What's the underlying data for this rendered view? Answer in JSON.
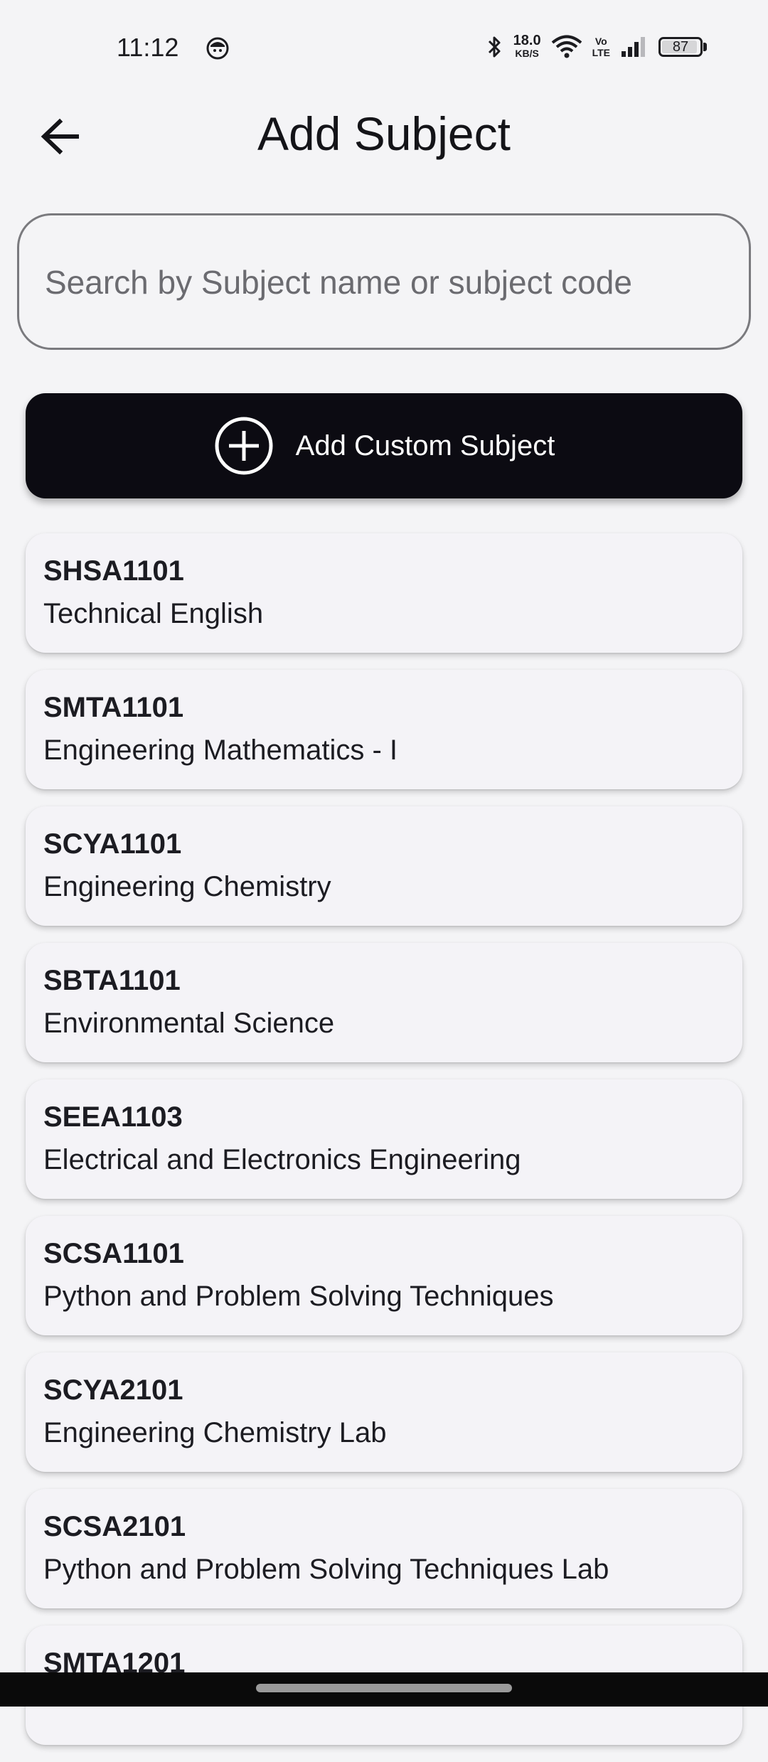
{
  "status_bar": {
    "time": "11:12",
    "net_speed": "18.0",
    "net_unit": "KB/S",
    "volte_top": "Vo",
    "volte_bottom": "LTE",
    "battery_level": "87",
    "icons": [
      "bluetooth-icon",
      "wifi-icon",
      "signal-icon",
      "battery-icon"
    ]
  },
  "header": {
    "title": "Add Subject",
    "back_icon": "arrow-left-icon"
  },
  "search": {
    "placeholder": "Search by Subject name or subject code",
    "value": ""
  },
  "add_custom": {
    "label": "Add Custom Subject",
    "icon": "add-circle-icon"
  },
  "subjects": [
    {
      "code": "SHSA1101",
      "name": "Technical English"
    },
    {
      "code": "SMTA1101",
      "name": "Engineering Mathematics - I"
    },
    {
      "code": "SCYA1101",
      "name": "Engineering Chemistry"
    },
    {
      "code": "SBTA1101",
      "name": "Environmental Science"
    },
    {
      "code": "SEEA1103",
      "name": "Electrical and Electronics Engineering"
    },
    {
      "code": "SCSA1101",
      "name": "Python and Problem Solving Techniques"
    },
    {
      "code": "SCYA2101",
      "name": "Engineering Chemistry Lab"
    },
    {
      "code": "SCSA2101",
      "name": "Python and Problem Solving Techniques Lab"
    },
    {
      "code": "SMTA1201",
      "name": ""
    }
  ],
  "colors": {
    "background": "#f4f4f6",
    "primary_button": "#0c0b12",
    "card": "#f4f3f7"
  }
}
